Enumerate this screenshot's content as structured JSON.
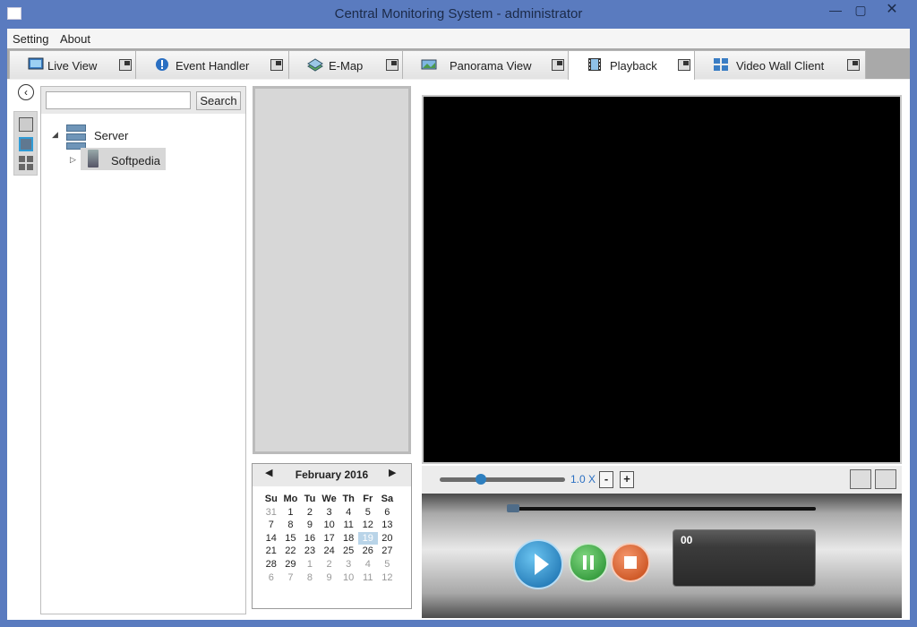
{
  "window": {
    "title": "Central Monitoring System - administrator",
    "min_glyph": "—",
    "max_glyph": "▢",
    "close_glyph": "✕"
  },
  "menu": {
    "items": [
      "Setting",
      "About"
    ]
  },
  "tabs": [
    {
      "label": "Live View",
      "icon": "live-view-icon",
      "active": false
    },
    {
      "label": "Event Handler",
      "icon": "event-handler-icon",
      "active": false
    },
    {
      "label": "E-Map",
      "icon": "emap-icon",
      "active": false
    },
    {
      "label": "Panorama View",
      "icon": "panorama-icon",
      "active": false
    },
    {
      "label": "Playback",
      "icon": "playback-icon",
      "active": true
    },
    {
      "label": "Video Wall Client",
      "icon": "video-wall-icon",
      "active": false
    }
  ],
  "sidebar": {
    "collapse_glyph": "‹"
  },
  "search": {
    "placeholder": "",
    "button_label": "Search"
  },
  "tree": {
    "root_label": "Server",
    "root_expander": "◢",
    "child_label": "Softpedia",
    "child_expander": "▷"
  },
  "calendar": {
    "title": "February 2016",
    "prev_glyph": "◀",
    "next_glyph": "▶",
    "weekdays": [
      "Su",
      "Mo",
      "Tu",
      "We",
      "Th",
      "Fr",
      "Sa"
    ],
    "weeks": [
      [
        "31",
        "1",
        "2",
        "3",
        "4",
        "5",
        "6"
      ],
      [
        "7",
        "8",
        "9",
        "10",
        "11",
        "12",
        "13"
      ],
      [
        "14",
        "15",
        "16",
        "17",
        "18",
        "19",
        "20"
      ],
      [
        "21",
        "22",
        "23",
        "24",
        "25",
        "26",
        "27"
      ],
      [
        "28",
        "29",
        "1",
        "2",
        "3",
        "4",
        "5"
      ],
      [
        "6",
        "7",
        "8",
        "9",
        "10",
        "11",
        "12"
      ]
    ],
    "selected_day": "19"
  },
  "playback": {
    "speed_label": "1.0 X",
    "speed_minus": "-",
    "speed_plus": "+",
    "speed_level": 0.3,
    "time_text": "00"
  }
}
